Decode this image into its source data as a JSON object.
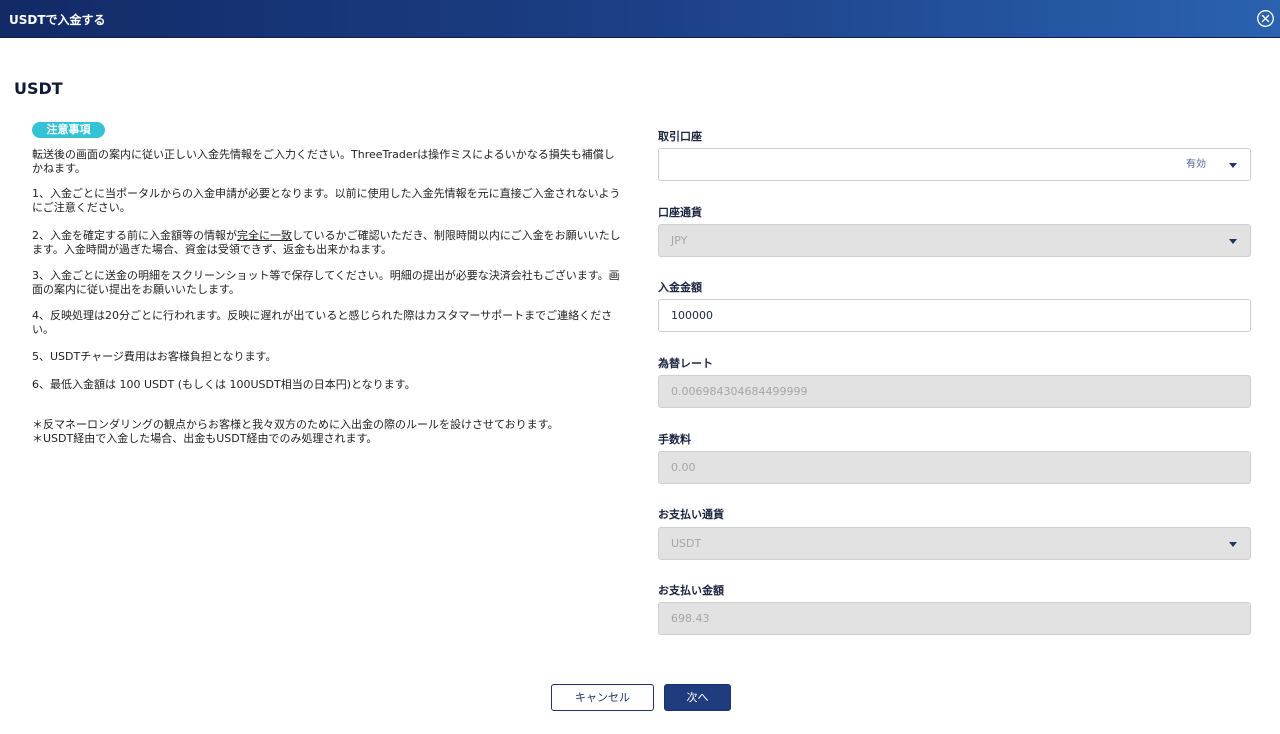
{
  "header": {
    "title": "USDTで入金する"
  },
  "section_title": "USDT",
  "notice": {
    "badge": "注意事項",
    "intro": "転送後の画面の案内に従い正しい入金先情報をご入力ください。ThreeTraderは操作ミスによるいかなる損失も補償しかねます。",
    "item1": "1、入金ごとに当ポータルからの入金申請が必要となります。以前に使用した入金先情報を元に直接ご入金されないようにご注意ください。",
    "item2_a": "2、入金を確定する前に入金額等の情報が",
    "item2_u": "完全に一致",
    "item2_b": "しているかご確認いただき、制限時間以内にご入金をお願いいたします。入金時間が過ぎた場合、資金は受領できず、返金も出来かねます。",
    "item3": "3、入金ごとに送金の明細をスクリーンショット等で保存してください。明細の提出が必要な決済会社もございます。画面の案内に従い提出をお願いいたします。",
    "item4": "4、反映処理は20分ごとに行われます。反映に遅れが出ていると感じられた際はカスタマーサポートまでご連絡ください。",
    "item5": "5、USDTチャージ費用はお客様負担となります。",
    "item6": "6、最低入金額は 100 USDT (もしくは 100USDT相当の日本円)となります。",
    "footnote1": "＊反マネーロンダリングの観点からお客様と我々双方のために入出金の際のルールを設けさせております。",
    "footnote2": "＊USDT経由で入金した場合、出金もUSDT経由でのみ処理されます。"
  },
  "form": {
    "account": {
      "label": "取引口座",
      "value": "",
      "status": "有効"
    },
    "currency": {
      "label": "口座通貨",
      "value": "JPY"
    },
    "amount": {
      "label": "入金金額",
      "value": "100000"
    },
    "rate": {
      "label": "為替レート",
      "value": "0.006984304684499999"
    },
    "fee": {
      "label": "手数料",
      "value": "0.00"
    },
    "pay_currency": {
      "label": "お支払い通貨",
      "value": "USDT"
    },
    "pay_amount": {
      "label": "お支払い金額",
      "value": "698.43"
    }
  },
  "buttons": {
    "cancel": "キャンセル",
    "next": "次へ"
  },
  "colors": {
    "header_start": "#122a66",
    "header_end": "#2a62b0",
    "badge": "#34c3d4",
    "primary": "#1f3c7f"
  },
  "icons": {
    "close": "close-circle-icon",
    "dropdown": "caret-down-icon"
  }
}
